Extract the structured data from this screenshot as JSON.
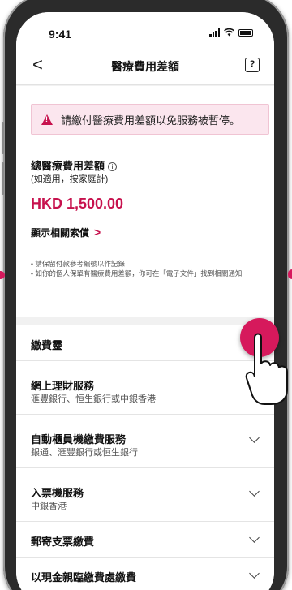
{
  "status_bar": {
    "time": "9:41"
  },
  "navbar": {
    "back_glyph": "<",
    "title": "醫療費用差額",
    "help_glyph": "?"
  },
  "alert": {
    "text": "請繳付醫療費用差額以免服務被暫停。",
    "icon": "warning-icon"
  },
  "summary": {
    "total_label": "總醫療費用差額",
    "info_glyph": "i",
    "total_sub": "(如適用，按家庭計)",
    "amount": "HKD 1,500.00",
    "show_claims": "顯示相關索償",
    "show_claims_chevron": ">"
  },
  "notes": [
    "• 請保留付款參考編號以作記錄",
    "• 如你的個人保單有醫療費用差額，你可在「電子文件」找到相關通知"
  ],
  "payment_methods": [
    {
      "title": "繳費靈",
      "sub": "",
      "expandable": false
    },
    {
      "title": "網上理財服務",
      "sub": "滙豐銀行、恒生銀行或中銀香港",
      "expandable": false
    },
    {
      "title": "自動櫃員機繳費服務",
      "sub": "銀通、滙豐銀行或恒生銀行",
      "expandable": true
    },
    {
      "title": "入票機服務",
      "sub": "中銀香港",
      "expandable": true
    },
    {
      "title": "郵寄支票繳費",
      "sub": "",
      "expandable": true
    },
    {
      "title": "以現金親臨繳費處繳費",
      "sub": "",
      "expandable": true
    }
  ],
  "colors": {
    "accent": "#c7124e",
    "alert_bg": "#fbe6ee",
    "tap_indicator": "#d6195c"
  }
}
